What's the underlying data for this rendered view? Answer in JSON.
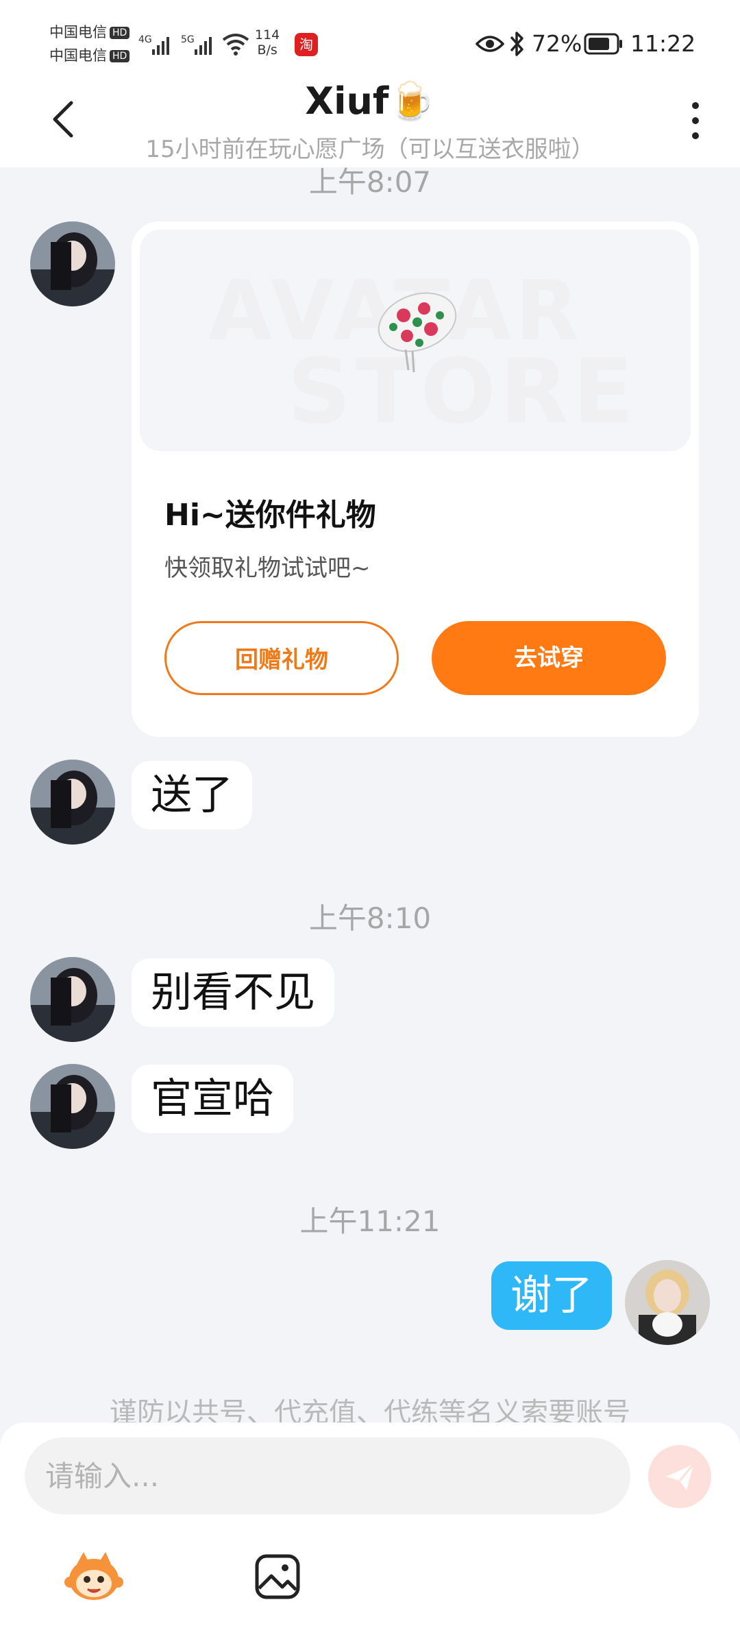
{
  "status_bar": {
    "carrier_1": "中国电信",
    "carrier_2": "中国电信",
    "hd": "HD",
    "net_1": "4G",
    "net_2": "5G",
    "speed_value": "114",
    "speed_unit": "B/s",
    "battery": "72%",
    "time": "11:22",
    "app_badge": "淘"
  },
  "header": {
    "title": "Xiuf🍺",
    "subtitle": "15小时前在玩心愿广场（可以互送衣服啦）"
  },
  "messages": {
    "time_1": "上午8:07",
    "gift_card": {
      "watermark_1": "AVATAR",
      "watermark_2": "STORE",
      "title": "Hi~送你件礼物",
      "subtitle": "快领取礼物试试吧~",
      "return_button": "回赠礼物",
      "tryon_button": "去试穿"
    },
    "msg_1": "送了",
    "time_2": "上午8:10",
    "msg_2": "别看不见",
    "msg_3": "官宣哈",
    "time_3": "上午11:21",
    "msg_out": "谢了"
  },
  "notice": "谨防以共号、代充值、代练等名义索要账号",
  "input": {
    "placeholder": "请输入..."
  },
  "colors": {
    "accent_orange": "#ff7a12",
    "outgoing_bubble": "#2fb8f7",
    "background": "#f2f4f7"
  }
}
